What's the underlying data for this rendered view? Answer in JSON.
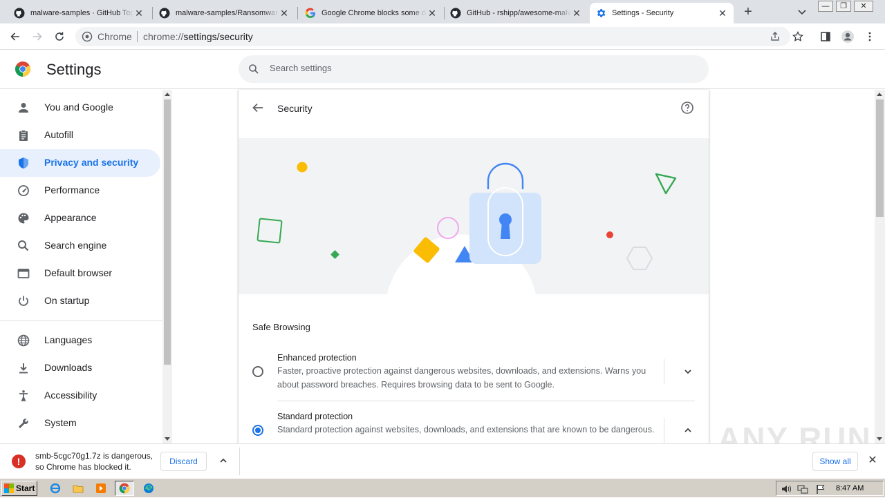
{
  "tabs": [
    {
      "title": "malware-samples · GitHub Topics",
      "icon": "github-icon",
      "active": false
    },
    {
      "title": "malware-samples/Ransomware",
      "icon": "github-icon",
      "active": false
    },
    {
      "title": "Google Chrome blocks some downloads",
      "icon": "google-icon",
      "active": false
    },
    {
      "title": "GitHub - rshipp/awesome-malware",
      "icon": "github-icon",
      "active": false
    },
    {
      "title": "Settings - Security",
      "icon": "settings-gear-icon",
      "active": true
    }
  ],
  "omnibox": {
    "site": "Chrome",
    "url_scheme": "chrome://",
    "url_path": "settings/security"
  },
  "header": {
    "title": "Settings",
    "search_placeholder": "Search settings"
  },
  "sidebar": {
    "items": [
      {
        "label": "You and Google",
        "icon": "person-icon"
      },
      {
        "label": "Autofill",
        "icon": "clipboard-icon"
      },
      {
        "label": "Privacy and security",
        "icon": "shield-icon",
        "active": true
      },
      {
        "label": "Performance",
        "icon": "speedometer-icon"
      },
      {
        "label": "Appearance",
        "icon": "palette-icon"
      },
      {
        "label": "Search engine",
        "icon": "search-icon"
      },
      {
        "label": "Default browser",
        "icon": "browser-icon"
      },
      {
        "label": "On startup",
        "icon": "power-icon"
      },
      {
        "label": "Languages",
        "icon": "globe-icon"
      },
      {
        "label": "Downloads",
        "icon": "download-icon"
      },
      {
        "label": "Accessibility",
        "icon": "accessibility-icon"
      },
      {
        "label": "System",
        "icon": "wrench-icon"
      }
    ]
  },
  "page": {
    "title": "Security",
    "section_title": "Safe Browsing",
    "options": [
      {
        "title": "Enhanced protection",
        "desc": "Faster, proactive protection against dangerous websites, downloads, and extensions. Warns you about password breaches. Requires browsing data to be sent to Google.",
        "selected": false,
        "expanded": false
      },
      {
        "title": "Standard protection",
        "desc": "Standard protection against websites, downloads, and extensions that are known to be dangerous.",
        "selected": true,
        "expanded": true
      }
    ]
  },
  "download_bar": {
    "message": "smb-5cgc70g1.7z is dangerous, so Chrome has blocked it.",
    "discard_label": "Discard",
    "show_all_label": "Show all"
  },
  "watermark": "ANY RUN",
  "taskbar": {
    "start_label": "Start",
    "clock": "8:47 AM"
  },
  "colors": {
    "accent": "#1a73e8",
    "active_bg": "#e8f0fe",
    "danger": "#d93025"
  }
}
